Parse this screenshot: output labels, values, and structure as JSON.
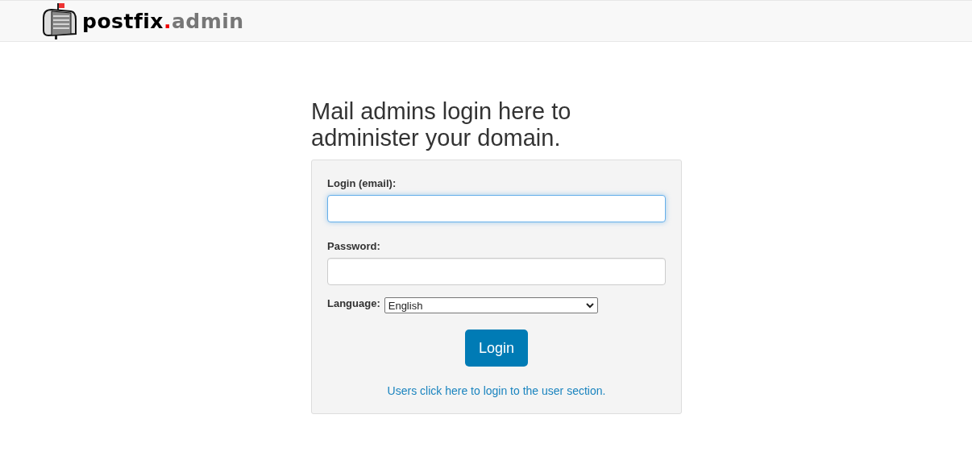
{
  "header": {
    "logo": {
      "name": "postfix",
      "dot": ".",
      "suffix": "admin"
    }
  },
  "heading": "Mail admins login here to administer your domain.",
  "form": {
    "fields": [
      {
        "label": "Login (email):",
        "focused": true
      },
      {
        "label": "Password:",
        "focused": false
      }
    ],
    "language": {
      "label": "Language:",
      "value": "English"
    },
    "submit": "Login",
    "user_link": "Users click here to login to the user section."
  }
}
